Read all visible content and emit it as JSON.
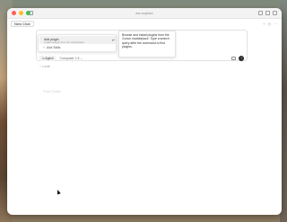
{
  "window": {
    "title": "ew-explore"
  },
  "tabs": [
    {
      "label": "New Chat"
    }
  ],
  "composer": {
    "input_value": "/add-plugin",
    "suggestion": {
      "title": "Add plugin",
      "subtitle": "Install a plugin from the marketplace",
      "add_label": "Add Skills"
    },
    "tooltip_text": "Browse and install plugins from the Cursor marketplace. Type a search query after the command to find plugins.",
    "mode_label": "Agent",
    "model_label": "Composer 1.5",
    "local_label": "Local"
  },
  "history": {
    "past_chats_label": "Past Chats"
  },
  "colors": {
    "send_button": "#2b2b2b",
    "traffic_red": "#ff5f57",
    "traffic_yellow": "#febc2e",
    "traffic_green": "#28c840"
  }
}
